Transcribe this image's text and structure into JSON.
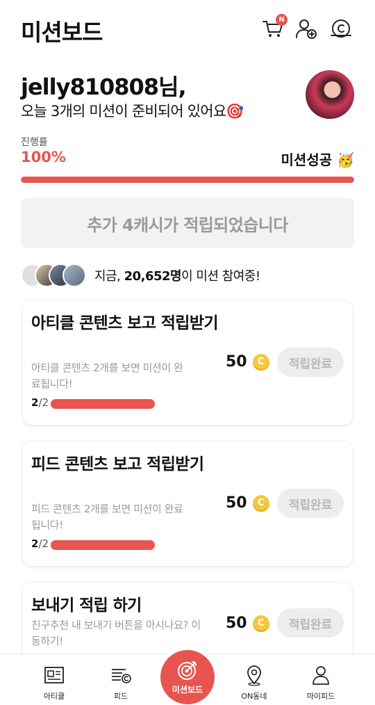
{
  "header": {
    "title": "미션보드",
    "cart_badge": "N",
    "icons": [
      "cart-icon",
      "add-friend-icon",
      "cash-icon"
    ]
  },
  "greeting": {
    "name": "jelly810808님,",
    "subtitle": "오늘 3개의 미션이 준비되어 있어요🎯"
  },
  "progress": {
    "label": "진행률",
    "value": "100%",
    "percent": 100,
    "status": "미션성공 🥳"
  },
  "bonus": {
    "text": "추가 4캐시가 적립되었습니다"
  },
  "participants": {
    "prefix": "지금, ",
    "count": "20,652명",
    "suffix": "이 미션 참여중!"
  },
  "missions": [
    {
      "title": "아티클 콘텐츠 보고 적립받기",
      "description": "아티클 콘텐츠 2개를 보면 미션이 완료됩니다!",
      "done": "2",
      "total": "/2",
      "progress": 1.0,
      "reward": "50",
      "coin": "C",
      "button": "적립완료"
    },
    {
      "title": "피드 콘텐츠 보고 적립받기",
      "description": "피드 콘텐츠 2개를 보면 미션이 완료됩니다!",
      "done": "2",
      "total": "/2",
      "progress": 1.0,
      "reward": "50",
      "coin": "C",
      "button": "적립완료"
    },
    {
      "title": "보내기 적립 하기",
      "description": "친구추천 내 보내기 버튼을 아시나요? 이동하기!",
      "reward": "50",
      "coin": "C",
      "button": "적립완료"
    }
  ],
  "nav": {
    "items": [
      "아티클",
      "피드",
      "미션보드",
      "ON동네",
      "마이피드"
    ],
    "active": "미션보드"
  },
  "colors": {
    "accent": "#e8544e",
    "coin": "#f4c842",
    "muted": "#9a9a9a"
  }
}
